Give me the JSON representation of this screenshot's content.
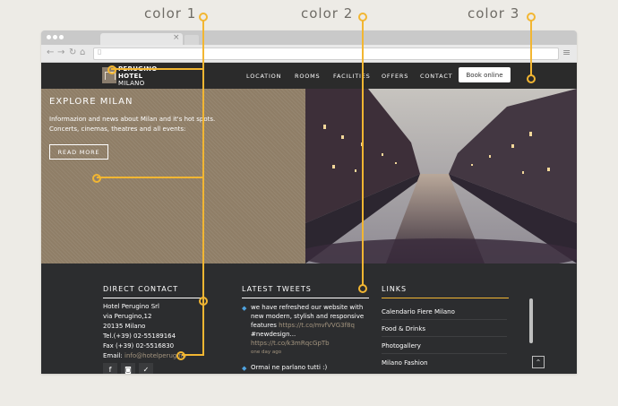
{
  "annotations": {
    "labels": [
      "color 1",
      "color 2",
      "color 3"
    ],
    "accent_color": "#f2b632"
  },
  "browser": {
    "tab_close": "×",
    "back_glyph": "←",
    "forward_glyph": "→",
    "reload_glyph": "↻",
    "home_glyph": "⌂",
    "menu_glyph": "≡"
  },
  "header": {
    "logo_line1": "PERUGINO",
    "logo_line2": "HOTEL",
    "logo_line3": "MILANO",
    "nav": [
      "LOCATION",
      "ROOMS",
      "FACILITIES",
      "OFFERS",
      "CONTACT"
    ],
    "book_button": "Book online"
  },
  "hero": {
    "title": "EXPLORE MILAN",
    "text": "Informazion  and news about Milan and it's hot spots. Concerts, cinemas, theatres and all events:",
    "button": "READ MORE"
  },
  "footer": {
    "contact": {
      "title": "DIRECT CONTACT",
      "lines": [
        "Hotel Perugino Srl",
        "via Perugino,12",
        "20135 Milano",
        "Tel.(+39) 02-55189164",
        "Fax (+39) 02-5516830"
      ],
      "email_label": "Email: ",
      "email_value": "info@hotelperugino",
      "social": [
        "f",
        "◙",
        "✓"
      ]
    },
    "tweets": {
      "title": "LATEST TWEETS",
      "tweet1_line1": "we have refreshed our website with",
      "tweet1_line2": "new modern, stylish and responsive",
      "tweet1_line3a": "features ",
      "tweet1_link1": "https://t.co/mvfVVG3f8q",
      "tweet1_line4": "#newdesign...",
      "tweet1_link2": "https://t.co/k3mRqcGpTb",
      "tweet1_time": "one day ago",
      "tweet2": "Ormai ne parlano tutti  :)"
    },
    "links": {
      "title": "LINKS",
      "items": [
        "Calendario Fiere Milano",
        "Food & Drinks",
        "Photogallery",
        "Milano Fashion"
      ]
    },
    "totop_glyph": "⌃"
  },
  "colors": {
    "hero_tan": "#8f7e67",
    "dark": "#2c2d2f",
    "rule_white": "#ffffff",
    "rule_accent": "#f2b632"
  }
}
